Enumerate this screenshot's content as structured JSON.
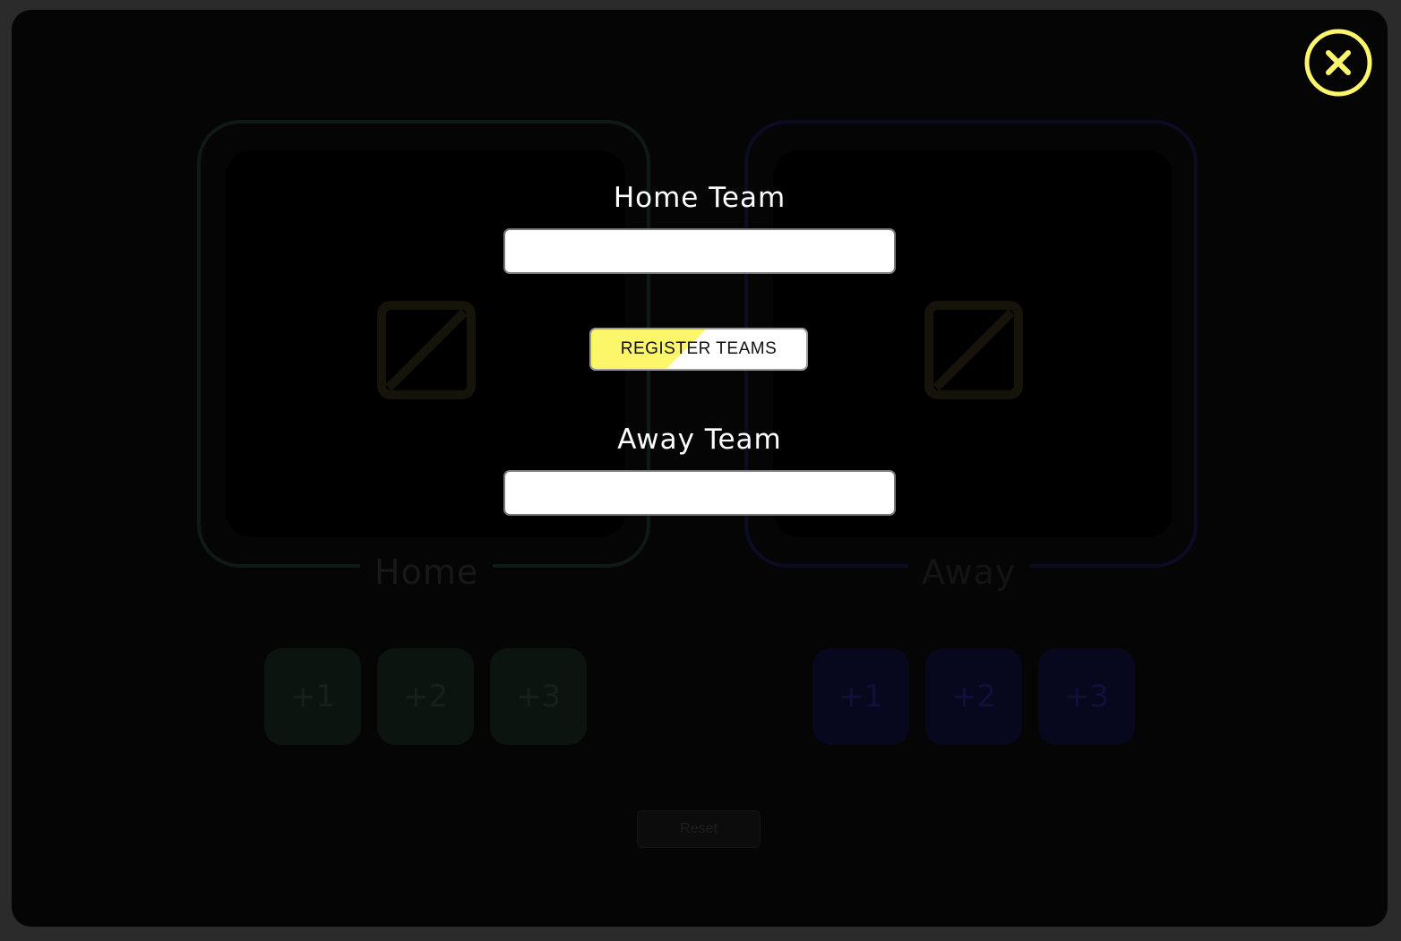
{
  "modal": {
    "home_team_label": "Home Team",
    "home_team_value": "",
    "register_button_label": "REGISTER TEAMS",
    "away_team_label": "Away Team",
    "away_team_value": "",
    "close_icon": "close-x-icon"
  },
  "scoreboard": {
    "home": {
      "label": "Home",
      "logo_icon": "image-placeholder-icon",
      "buttons": [
        "+1",
        "+2",
        "+3"
      ]
    },
    "away": {
      "label": "Away",
      "logo_icon": "image-placeholder-icon",
      "buttons": [
        "+1",
        "+2",
        "+3"
      ]
    },
    "reset_label": "Reset"
  },
  "colors": {
    "accent_yellow": "#fbf66a",
    "background": "#050505",
    "outer": "#2b2b2b"
  }
}
